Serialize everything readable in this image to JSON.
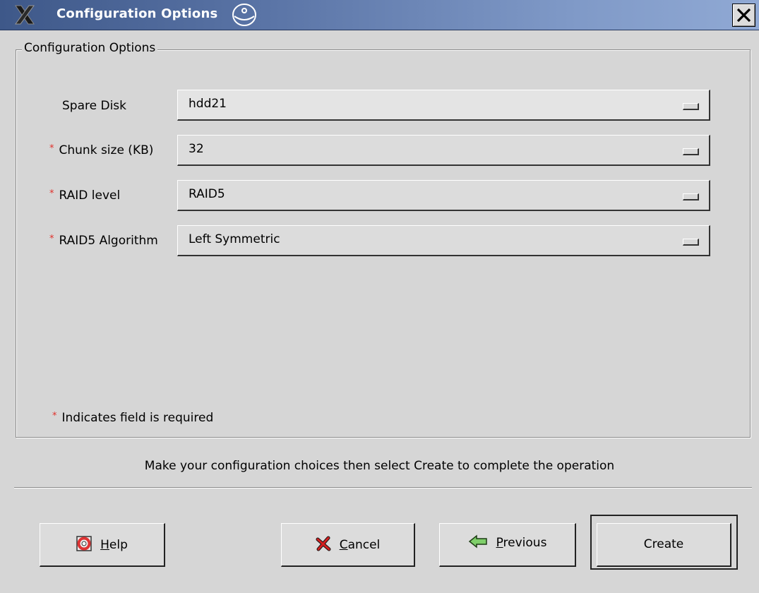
{
  "window": {
    "title": "Configuration Options",
    "close_icon": "close-x-icon",
    "app_icon": "x-logo-icon",
    "decor_icon": "globe-icon"
  },
  "group": {
    "legend": "Configuration Options",
    "fields": [
      {
        "label": "Spare Disk",
        "required": false,
        "value": "hdd21"
      },
      {
        "label": "Chunk size (KB)",
        "required": true,
        "value": "32"
      },
      {
        "label": "RAID level",
        "required": true,
        "value": "RAID5"
      },
      {
        "label": "RAID5 Algorithm",
        "required": true,
        "value": "Left Symmetric"
      }
    ],
    "required_mark": "*",
    "required_note": "Indicates field is required"
  },
  "hint": "Make your configuration choices then select Create to complete the operation",
  "buttons": {
    "help": {
      "mnemonic": "H",
      "rest": "elp",
      "icon": "lifebuoy-icon"
    },
    "cancel": {
      "mnemonic": "C",
      "rest": "ancel",
      "icon": "red-x-icon"
    },
    "previous": {
      "mnemonic": "P",
      "rest": "revious",
      "icon": "arrow-left-icon"
    },
    "create": {
      "label": "Create"
    }
  },
  "colors": {
    "titlebar_start": "#3e5889",
    "titlebar_end": "#90a9d4",
    "required": "#e0302a",
    "background": "#d6d6d6"
  }
}
